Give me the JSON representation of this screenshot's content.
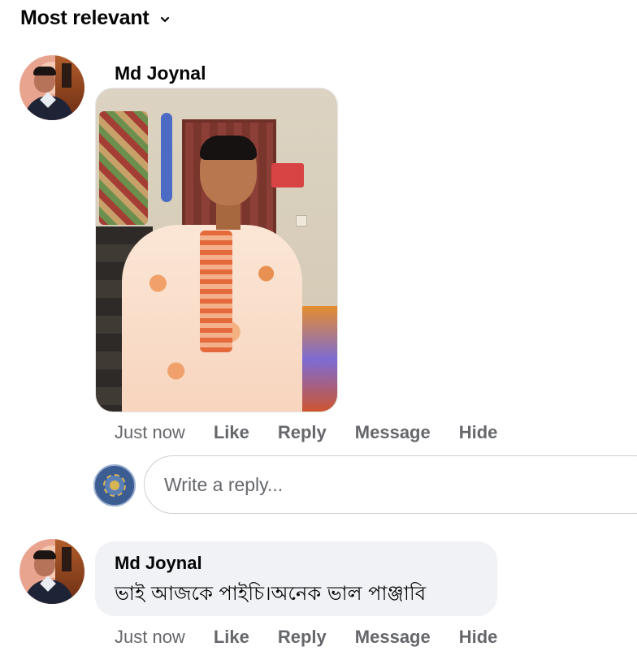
{
  "sort": {
    "label": "Most relevant"
  },
  "comments": [
    {
      "author": "Md Joynal",
      "has_photo": true,
      "actions": {
        "time": "Just now",
        "like": "Like",
        "reply": "Reply",
        "message": "Message",
        "hide": "Hide"
      }
    },
    {
      "author": "Md Joynal",
      "text": "ভাই আজকে পাইচি।অনেক ভাল  পাঞ্জাবি",
      "actions": {
        "time": "Just now",
        "like": "Like",
        "reply": "Reply",
        "message": "Message",
        "hide": "Hide"
      }
    }
  ],
  "reply_box": {
    "placeholder": "Write a reply..."
  },
  "colors": {
    "secondary_text": "#65676b",
    "bubble_bg": "#f0f2f5",
    "input_border": "#ccd0d5"
  },
  "icons": {
    "sort_toggle": "chevron-down-icon"
  }
}
